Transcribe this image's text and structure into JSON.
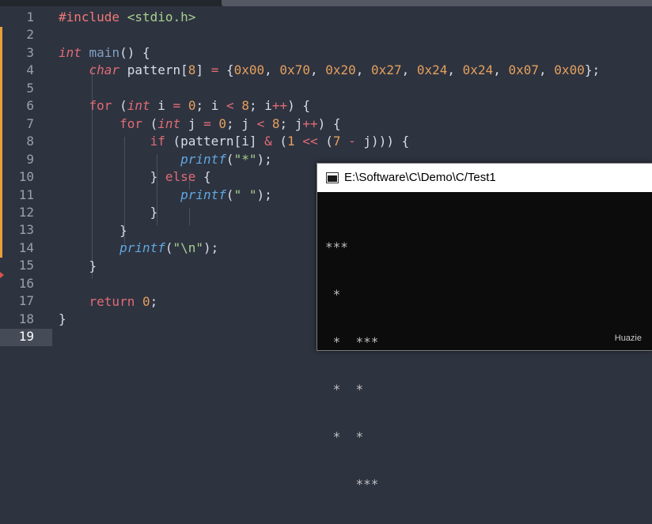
{
  "editor": {
    "line_numbers": [
      "1",
      "2",
      "3",
      "4",
      "5",
      "6",
      "7",
      "8",
      "9",
      "10",
      "11",
      "12",
      "13",
      "14",
      "15",
      "16",
      "17",
      "18",
      "19"
    ],
    "active_line": "19",
    "code": {
      "l1": {
        "directive": "#include",
        "header": "<stdio.h>"
      },
      "l3": {
        "type": "int",
        "name": "main",
        "rest": "() {"
      },
      "l4": {
        "type": "char",
        "var": "pattern[",
        "size": "8",
        "close": "]",
        "eq": "=",
        "open": "{",
        "v1": "0x00",
        "v2": "0x70",
        "v3": "0x20",
        "v4": "0x27",
        "v5": "0x24",
        "v6": "0x24",
        "v7": "0x07",
        "v8": "0x00",
        "comma": ",",
        "end": "};"
      },
      "l6": {
        "kw": "for",
        "p1": "(",
        "type": "int",
        "v": "i",
        "eq": "=",
        "n0": "0",
        "s1": ";",
        "v2": "i",
        "lt": "<",
        "n8": "8",
        "s2": ";",
        "inc": "i",
        "pp": "++",
        "end": ") {"
      },
      "l7": {
        "kw": "for",
        "p1": "(",
        "type": "int",
        "v": "j",
        "eq": "=",
        "n0": "0",
        "s1": ";",
        "v2": "j",
        "lt": "<",
        "n8": "8",
        "s2": ";",
        "inc": "j",
        "pp": "++",
        "end": ") {"
      },
      "l8": {
        "kw": "if",
        "p1": "(pattern[i]",
        "amp": "&",
        "p2": "(",
        "n1": "1",
        "shl": "<<",
        "p3": "(",
        "n7": "7",
        "minus": "-",
        "rest": "j))) {"
      },
      "l9": {
        "fn": "printf",
        "open": "(",
        "str": "\"*\"",
        "close": ");"
      },
      "l10": {
        "close": "}",
        "kw": "else",
        "open": "{"
      },
      "l11": {
        "fn": "printf",
        "open": "(",
        "str": "\" \"",
        "close": ");"
      },
      "l12": {
        "close": "}"
      },
      "l13": {
        "close": "}"
      },
      "l14": {
        "fn": "printf",
        "open": "(",
        "str": "\"\\n\"",
        "close": ");"
      },
      "l15": {
        "close": "}"
      },
      "l17": {
        "kw": "return",
        "num": "0",
        "end": ";"
      },
      "l18": {
        "close": "}"
      }
    }
  },
  "console": {
    "title": "E:\\Software\\C\\Demo\\C/Test1",
    "output_lines": [
      "***",
      " *",
      " *  ***",
      " *  *",
      " *  *",
      "    ***"
    ],
    "watermark": "Huazie"
  },
  "colors": {
    "editor_bg": "#2e3340",
    "keyword": "#e06c75",
    "function": "#5fa8e0",
    "number": "#e5a05c",
    "string": "#a8d08d",
    "console_bg": "#0c0c0c"
  }
}
